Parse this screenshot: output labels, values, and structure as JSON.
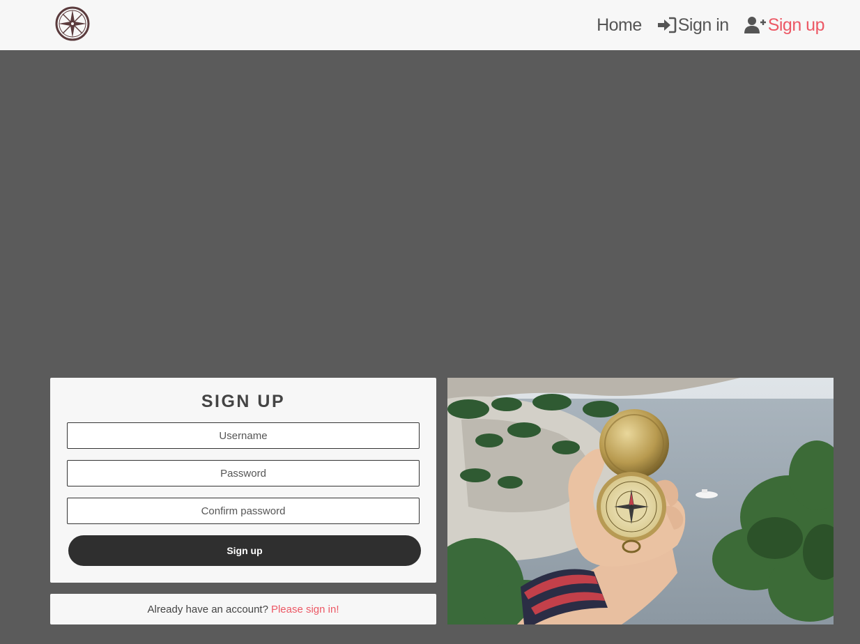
{
  "navbar": {
    "logo_icon": "compass-rose-icon",
    "links": [
      {
        "label": "Home",
        "icon": ""
      },
      {
        "label": "Sign in",
        "icon": "sign-in-icon"
      },
      {
        "label": "Sign up",
        "icon": "user-plus-icon"
      }
    ],
    "active_link": "Sign up",
    "link_color": "#555555",
    "active_color": "#ec5865",
    "background": "#f7f7f7"
  },
  "page": {
    "background": "#5b5b5b"
  },
  "form": {
    "title": "Sign up",
    "fields": [
      {
        "name": "username",
        "placeholder": "Username",
        "value": ""
      },
      {
        "name": "password",
        "placeholder": "Password",
        "value": ""
      },
      {
        "name": "confirm_password",
        "placeholder": "Confirm password",
        "value": ""
      }
    ],
    "submit_label": "Sign up",
    "submit_color": "#2f2f2f"
  },
  "signin_prompt": {
    "text": "Already have an account?",
    "link_label": "Please sign in!"
  },
  "hero_image": {
    "subject": "compass-in-hand-photo"
  }
}
